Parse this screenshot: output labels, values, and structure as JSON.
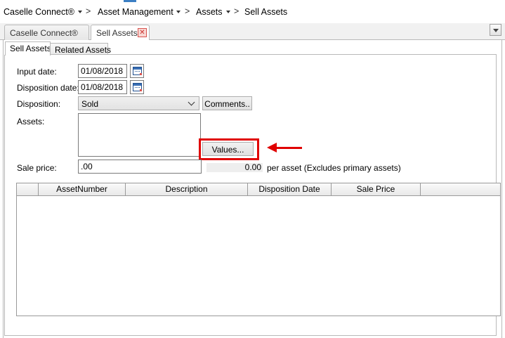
{
  "breadcrumb": {
    "items": [
      "Caselle Connect®",
      "Asset Management",
      "Assets",
      "Sell Assets"
    ],
    "separator": ">"
  },
  "tabs": [
    {
      "label": "Caselle Connect®"
    },
    {
      "label": "Sell Assets",
      "close_icon": "close-icon"
    }
  ],
  "subtabs": [
    {
      "label": "Sell Assets"
    },
    {
      "label": "Related Assets"
    }
  ],
  "form": {
    "input_date_label": "Input date:",
    "input_date_value": "01/08/2018",
    "disposition_date_label": "Disposition date:",
    "disposition_date_value": "01/08/2018",
    "disposition_label": "Disposition:",
    "disposition_value": "Sold",
    "comments_button": "Comments..",
    "assets_label": "Assets:",
    "values_button": "Values...",
    "sale_price_label": "Sale price:",
    "sale_price_value": ".00",
    "per_asset_value": "0.00",
    "per_asset_text": "per asset (Excludes primary assets)"
  },
  "grid": {
    "columns": [
      "AssetNumber",
      "Description",
      "Disposition Date",
      "Sale Price"
    ],
    "rows": []
  },
  "colors": {
    "highlight": "#e00000",
    "tab_close": "#d9534f"
  }
}
